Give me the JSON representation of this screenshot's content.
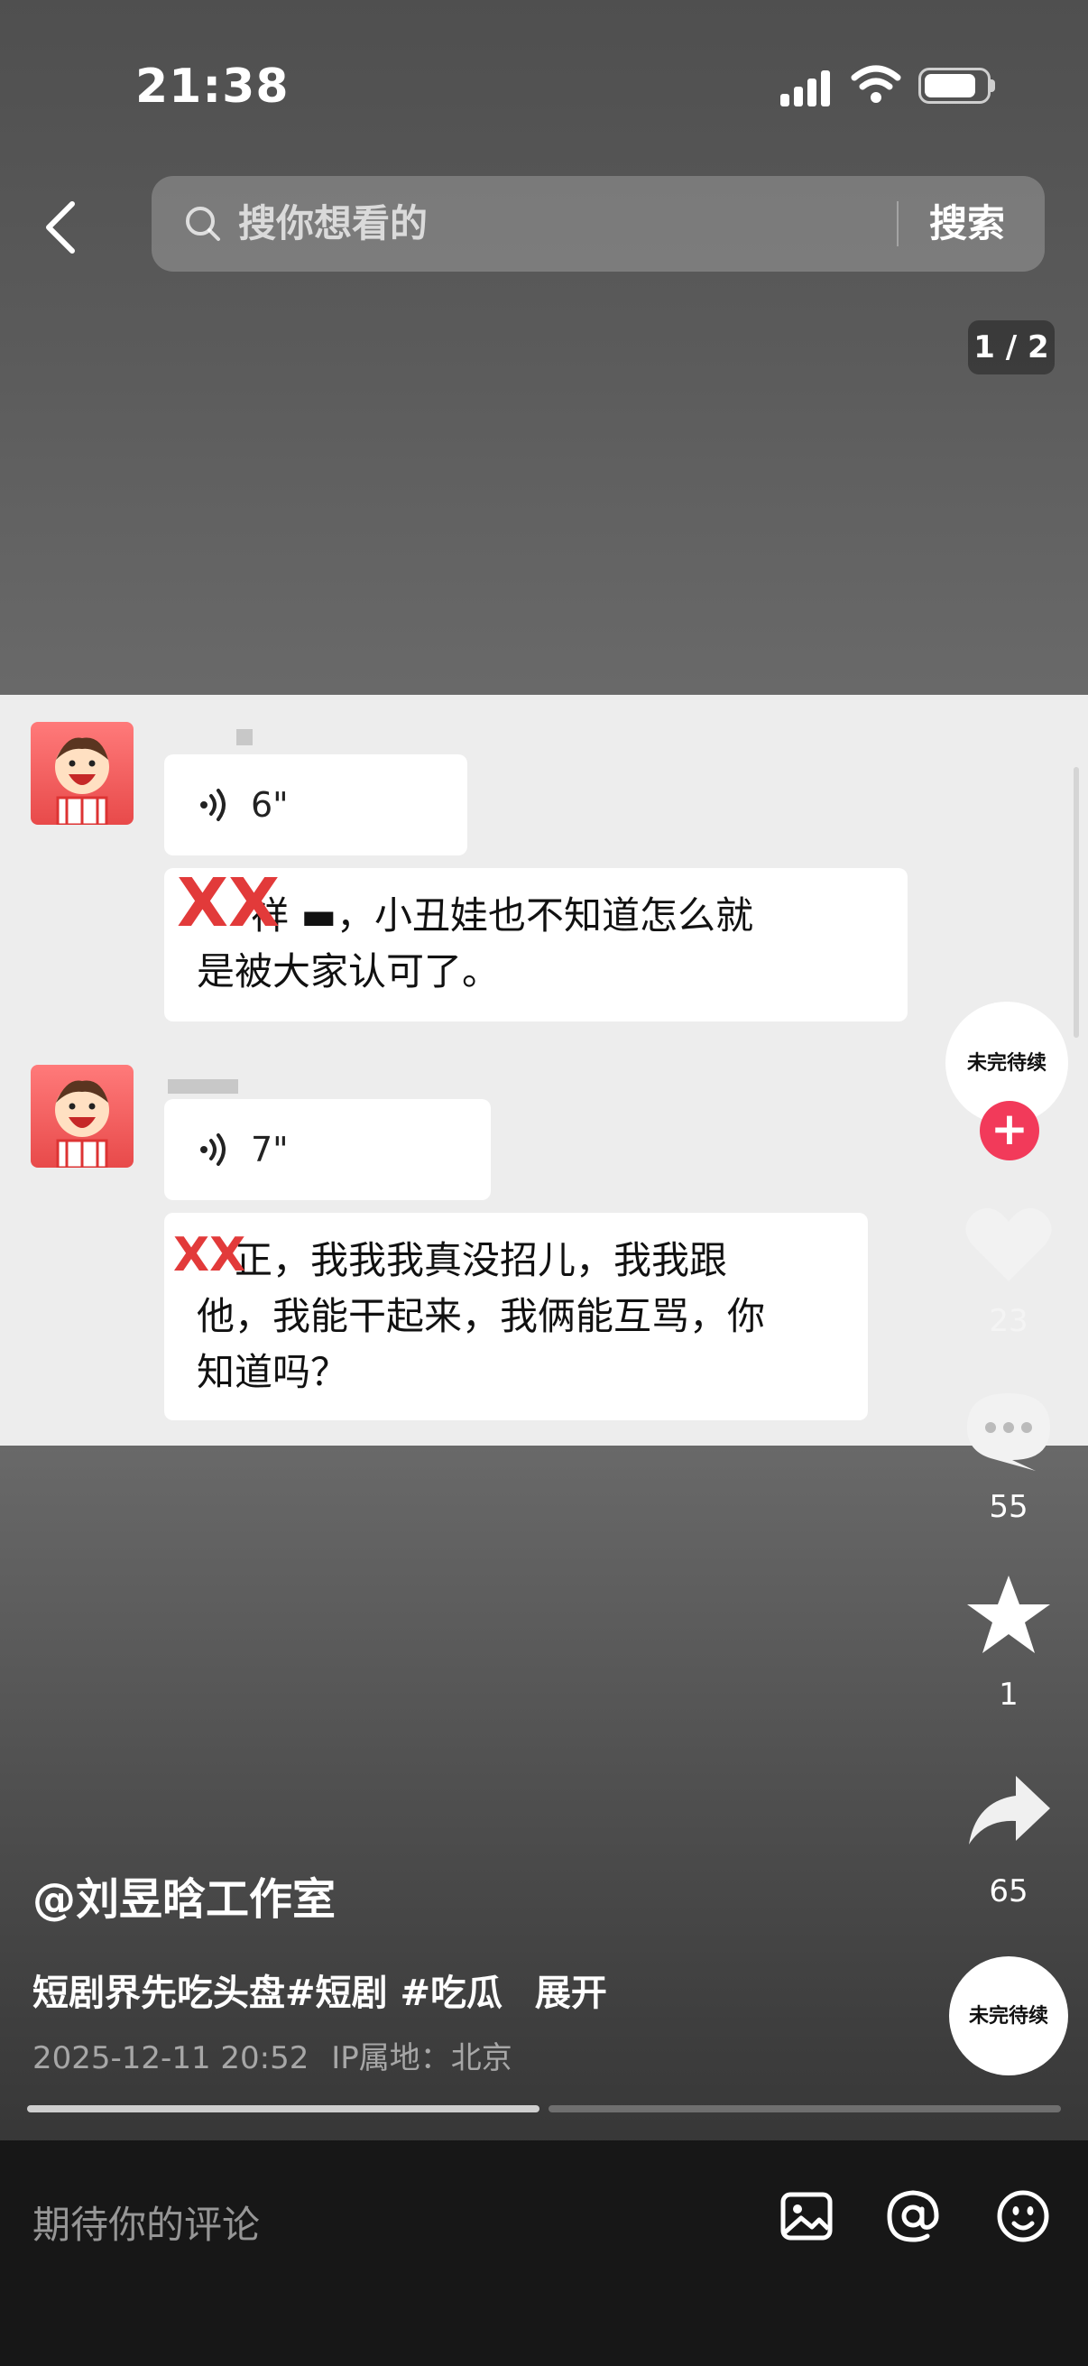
{
  "status_bar": {
    "time": "21:38",
    "battery_percent": 85
  },
  "search": {
    "placeholder": "搜你想看的",
    "submit_label": "搜索"
  },
  "page_indicator": "1 / 2",
  "chat": {
    "messages": [
      {
        "type": "voice",
        "duration": "6\""
      },
      {
        "type": "text",
        "xx": "XX",
        "text_line1": "祥 ▬，小丑娃也不知道怎么就",
        "text_line2": "是被大家认可了。"
      },
      {
        "type": "voice",
        "duration": "7\""
      },
      {
        "type": "text",
        "xx": "XX",
        "text_line1": "正，我我我真没招儿，我我跟",
        "text_line2": "他，我能干起来，我俩能互骂，你",
        "text_line3": "知道吗？"
      }
    ]
  },
  "right_rail": {
    "disc_label": "未完待续",
    "like_count": "23",
    "comment_count": "55",
    "favorite_count": "1",
    "share_count": "65"
  },
  "caption": {
    "author": "@刘昱晗工作室",
    "description": "短剧界先吃头盘#短剧 #吃瓜",
    "expand_label": "展开",
    "timestamp": "2025-12-11 20:52",
    "ip_location": "IP属地：北京"
  },
  "progress": {
    "segments": 2,
    "current": 1
  },
  "comment_bar": {
    "placeholder": "期待你的评论"
  },
  "colors": {
    "accent": "#f23a5a",
    "chat_bg": "#ededed",
    "bar_bg": "#171717"
  }
}
